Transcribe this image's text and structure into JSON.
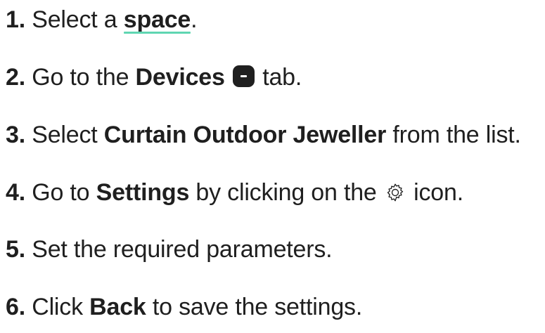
{
  "steps": [
    {
      "num": "1.",
      "pre": "Select a",
      "link": "space",
      "post": "."
    },
    {
      "num": "2.",
      "pre": "Go to the",
      "bold": "Devices",
      "post": "tab."
    },
    {
      "num": "3.",
      "pre": "Select",
      "bold": "Curtain Outdoor Jeweller",
      "post": "from the list."
    },
    {
      "num": "4.",
      "pre": "Go to",
      "bold": "Settings",
      "mid": "by clicking on the",
      "post": "icon."
    },
    {
      "num": "5.",
      "text": "Set the required parameters."
    },
    {
      "num": "6.",
      "pre": "Click",
      "bold": "Back",
      "post": "to save the settings."
    }
  ],
  "colors": {
    "text": "#1f1f1f",
    "link_underline": "#5fd6b2"
  },
  "icons": {
    "devices": "devices-tab-icon",
    "settings": "gear-icon"
  }
}
